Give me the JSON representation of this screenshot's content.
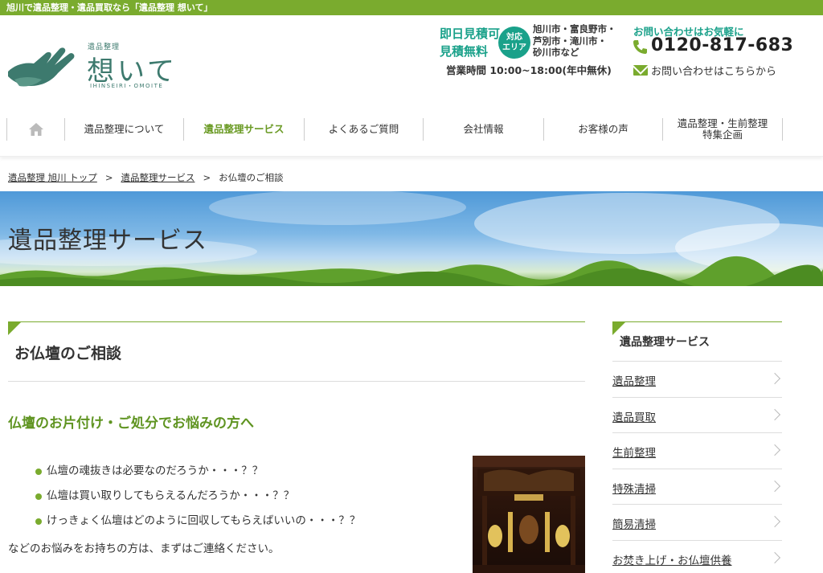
{
  "topbar": {
    "text": "旭川で遺品整理・遺品買取なら「遺品整理 想いて」"
  },
  "logo": {
    "small": "遺品整理",
    "main": "想いて",
    "roman": "IHINSEIRI・OMOITE"
  },
  "header": {
    "quote_line1": "即日見積可",
    "quote_line2": "見積無料",
    "area_badge_line1": "対応",
    "area_badge_line2": "エリア",
    "areas_line1": "旭川市・富良野市・",
    "areas_line2": "芦別市・滝川市・",
    "areas_line3": "砂川市など",
    "hours": "営業時間 10:00~18:00(年中無休)",
    "contact_lead": "お問い合わせはお気軽に",
    "phone": "0120-817-683",
    "mail_link": "お問い合わせはこちらから",
    "accent_color": "#1aa18a",
    "brand_green": "#7aab2e"
  },
  "nav": {
    "home_icon": "home-icon",
    "items": [
      {
        "label": "遺品整理について"
      },
      {
        "label": "遺品整理サービス"
      },
      {
        "label": "よくあるご質問"
      },
      {
        "label": "会社情報"
      },
      {
        "label": "お客様の声"
      },
      {
        "label_line1": "遺品整理・生前整理",
        "label_line2": "特集企画"
      }
    ]
  },
  "breadcrumb": {
    "items": [
      "遺品整理 旭川 トップ",
      "遺品整理サービス",
      "お仏壇のご相談"
    ],
    "separator": ">"
  },
  "hero": {
    "title": "遺品整理サービス"
  },
  "main": {
    "heading": "お仏壇のご相談",
    "sub_heading": "仏壇のお片付け・ご処分でお悩みの方へ",
    "bullets": [
      "仏壇の魂抜きは必要なのだろうか・・・？？",
      "仏壇は買い取りしてもらえるんだろうか・・・？？",
      "けっきょく仏壇はどのように回収してもらえばいいの・・・？？"
    ],
    "paragraph": "などのお悩みをお持ちの方は、まずはご連絡ください。"
  },
  "sidebar": {
    "heading": "遺品整理サービス",
    "items": [
      {
        "label": "遺品整理"
      },
      {
        "label": "遺品買取"
      },
      {
        "label": "生前整理"
      },
      {
        "label": "特殊清掃"
      },
      {
        "label": "簡易清掃"
      },
      {
        "label": "お焚き上げ・お仏壇供養"
      }
    ]
  }
}
